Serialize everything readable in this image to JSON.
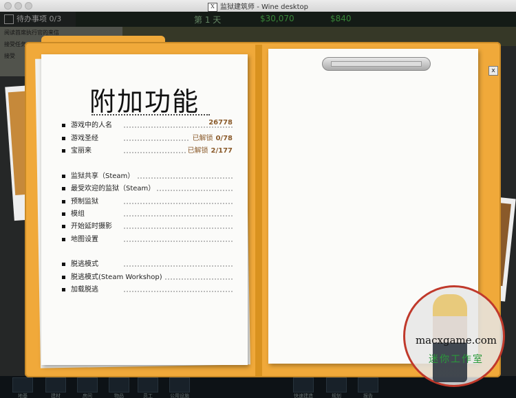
{
  "window": {
    "title": "监狱建筑师 - Wine desktop"
  },
  "hud": {
    "todo_label": "待办事项 0/3",
    "day_label": "第 1 天",
    "balance": "$30,070",
    "income": "$840",
    "left_tasks": [
      "阅读首席执行官的来信",
      "接受任务",
      "接受"
    ]
  },
  "extras": {
    "title": "附加功能",
    "stats": [
      {
        "label": "游戏中的人名",
        "status": "",
        "value": "26778"
      },
      {
        "label": "游戏圣经",
        "status": "已解锁",
        "value": "0/78"
      },
      {
        "label": "宝丽来",
        "status": "已解锁",
        "value": "2/177"
      }
    ],
    "menu_group1": [
      "监狱共享（Steam）",
      "最受欢迎的监狱（Steam）",
      "预制监狱",
      "模组",
      "开始延时摄影",
      "地图设置"
    ],
    "menu_group2": [
      "脱逃模式",
      "脱逃模式(Steam Workshop)",
      "加载脱逃"
    ],
    "close_label": "x"
  },
  "toolbar": {
    "items": [
      "地基",
      "建材",
      "房间",
      "物品",
      "员工",
      "公用设施",
      "",
      "",
      "快速建造",
      "规划",
      "报告",
      "",
      "报告"
    ]
  },
  "watermark": {
    "site": "macxgame.com",
    "studio": "迷你工作室"
  }
}
